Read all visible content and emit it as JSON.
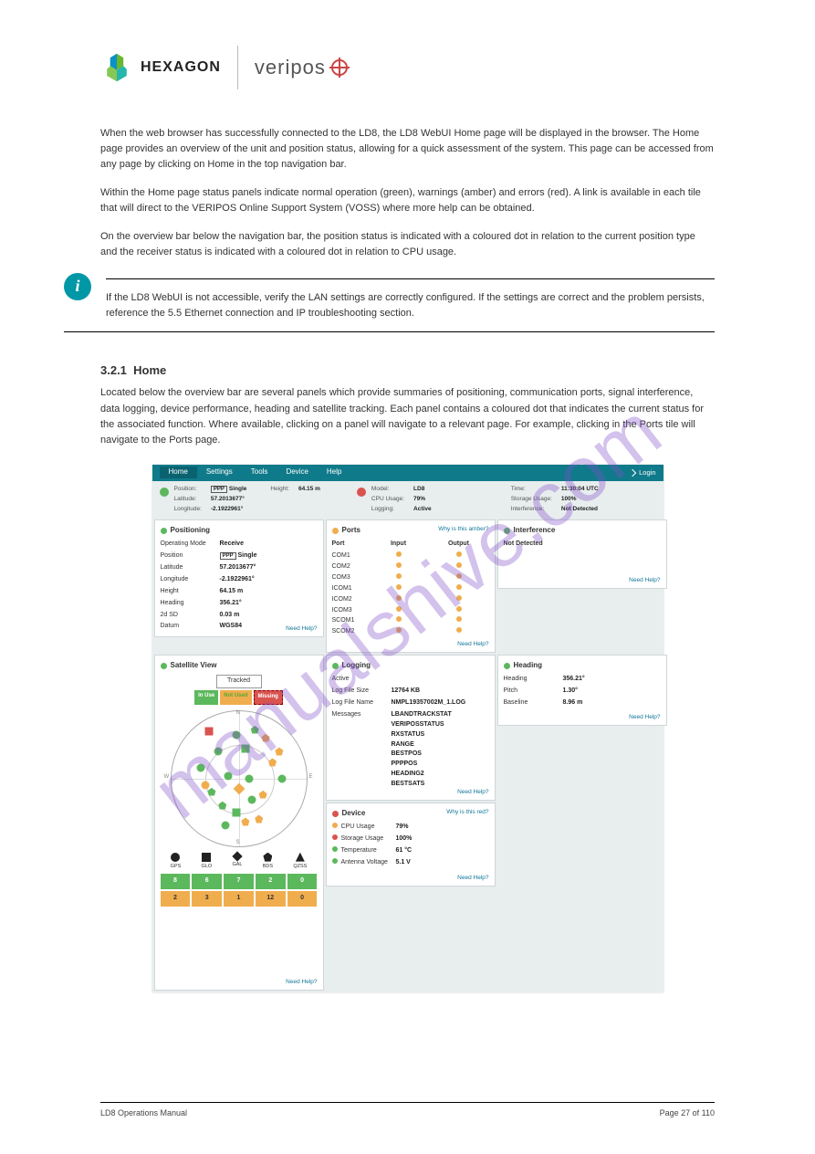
{
  "brand": {
    "hexagon": "HEXAGON",
    "veripos": "veripos"
  },
  "doc": {
    "title": "LD8 Operations Manual",
    "footer_right": "Page 27 of 110"
  },
  "watermark": "manualshive.com",
  "section": {
    "p1": "When the web browser has successfully connected to the LD8, the LD8 WebUI Home page will be displayed in the browser. The Home page provides an overview of the unit and position status, allowing for a quick assessment of the system. This page can be accessed from any page by clicking on Home in the top navigation bar.",
    "p2": "Within the Home page status panels indicate normal operation (green), warnings (amber) and errors (red). A link is available in each tile that will direct to the VERIPOS Online Support System (VOSS) where more help can be obtained.",
    "p3": "On the overview bar below the navigation bar, the position status is indicated with a coloured dot in relation to the current position type and the receiver status is indicated with a coloured dot in relation to CPU usage.",
    "note_heading": "",
    "note": "If the LD8 WebUI is not accessible, verify the LAN settings are correctly configured. If the settings are correct and the problem persists, reference the 5.5 Ethernet connection and IP troubleshooting section.",
    "num": "3.2.1",
    "title": "Home",
    "p4": "Located below the overview bar are several panels which provide summaries of positioning, communication ports, signal interference, data logging, device performance, heading and satellite tracking. Each panel contains a coloured dot that indicates the current status for the associated function. Where available, clicking on a panel will navigate to a relevant page. For example, clicking in the Ports tile will navigate to the Ports page."
  },
  "ui": {
    "nav": {
      "home": "Home",
      "settings": "Settings",
      "tools": "Tools",
      "device": "Device",
      "help": "Help",
      "login": "Login"
    },
    "topbar": {
      "left": {
        "position": "Position:",
        "lat": "Latitude:",
        "lon": "Longitude:",
        "height": "Height:",
        "posv": "Single",
        "latv": "57.2013677°",
        "lonv": "-2.1922961°",
        "heightv": "64.15 m"
      },
      "mid": {
        "model": "Model:",
        "cpu": "CPU Usage:",
        "log": "Logging:",
        "modelv": "LD8",
        "cpuv": "79%",
        "logv": "Active"
      },
      "right": {
        "time": "Time:",
        "storage": "Storage Usage:",
        "interf": "Interference:",
        "timev": "11:30:04 UTC",
        "storagev": "100%",
        "interfv": "Not Detected"
      }
    },
    "positioning": {
      "title": "Positioning",
      "rows": {
        "opmode_l": "Operating Mode",
        "opmode": "Receive",
        "pos_l": "Position",
        "pos": "Single",
        "lat_l": "Latitude",
        "lat": "57.2013677°",
        "lon_l": "Longitude",
        "lon": "-2.1922961°",
        "h_l": "Height",
        "h": "64.15 m",
        "hd_l": "Heading",
        "hd": "356.21°",
        "sd_l": "2d SD",
        "sd": "0.03 m",
        "dat_l": "Datum",
        "dat": "WGS84"
      },
      "help": "Need Help?"
    },
    "ports": {
      "title": "Ports",
      "amber_link": "Why is this amber?",
      "head_port": "Port",
      "head_in": "Input",
      "head_out": "Output",
      "rows": [
        "COM1",
        "COM2",
        "COM3",
        "ICOM1",
        "ICOM2",
        "ICOM3",
        "SCOM1",
        "SCOM2"
      ],
      "help": "Need Help?"
    },
    "interference": {
      "title": "Interference",
      "val": "Not Detected",
      "help": "Need Help?"
    },
    "heading": {
      "title": "Heading",
      "hd_l": "Heading",
      "hd": "356.21°",
      "p_l": "Pitch",
      "p": "1.30°",
      "b_l": "Baseline",
      "b": "8.96 m",
      "help": "Need Help?"
    },
    "logging": {
      "title": "Logging",
      "active": "Active",
      "size_l": "Log File Size",
      "size": "12764 KB",
      "name_l": "Log File Name",
      "name": "NMPL19357002M_1.LOG",
      "msg_l": "Messages",
      "msgs": [
        "LBANDTRACKSTAT",
        "VERIPOSSTATUS",
        "RXSTATUS",
        "RANGE",
        "BESTPOS",
        "PPPPOS",
        "HEADING2",
        "BESTSATS"
      ],
      "help": "Need Help?"
    },
    "device": {
      "title": "Device",
      "red_link": "Why is this red?",
      "cpu_l": "CPU Usage",
      "cpu": "79%",
      "st_l": "Storage Usage",
      "st": "100%",
      "t_l": "Temperature",
      "t": "61 °C",
      "v_l": "Antenna Voltage",
      "v": "5.1 V",
      "help": "Need Help?"
    },
    "satview": {
      "title": "Satellite View",
      "tracked": "Tracked",
      "leg_iu": "In Use",
      "leg_nu": "Not Used",
      "leg_ms": "Missing",
      "shapes": {
        "gps": "GPS",
        "glo": "GLO",
        "gal": "GAL",
        "bds": "BDS",
        "qzss": "QZSS"
      },
      "counts_g": [
        "8",
        "6",
        "7",
        "2",
        "0"
      ],
      "counts_a": [
        "2",
        "3",
        "1",
        "12",
        "0"
      ],
      "help": "Need Help?"
    }
  }
}
